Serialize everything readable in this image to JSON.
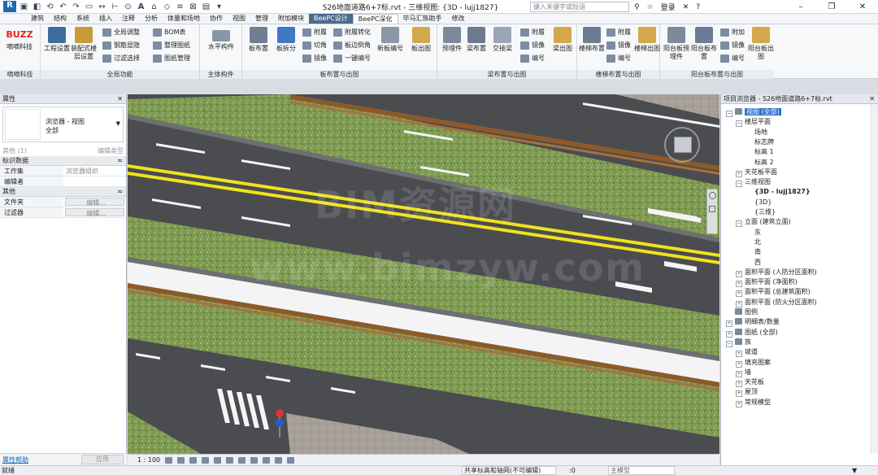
{
  "titlebar": {
    "doc_title": "S26地面道路6+7标.rvt - 三维视图: {3D - lujj1827}",
    "search_placeholder": "键入关键字或短语",
    "login": "登录",
    "help": "?"
  },
  "tabs": [
    "建筑",
    "结构",
    "系统",
    "插入",
    "注释",
    "分析",
    "体量和场地",
    "协作",
    "视图",
    "管理",
    "附加模块",
    "BeePC设计",
    "BeePC深化",
    "毕马汇族助手",
    "修改"
  ],
  "ribbon": {
    "panels": {
      "p1": "嘀嘀科技",
      "p2": "全局功能",
      "p3": "主体构件",
      "p4": "板布置与出图",
      "p5": "梁布置与出图",
      "p6": "楼梯布置与出图",
      "p7": "阳台板布置与出图"
    },
    "buzz_logo": "BUZZ",
    "buttons": {
      "dd": "嘀嘀科技",
      "gcsz": "工程设置",
      "zpslc": "装配式楼层设置",
      "qjtz": "全局调整",
      "gjyc": "钢筋显隐",
      "glxz": "过滤选择",
      "bom": "BOM表",
      "zltz": "整理图纸",
      "tzgl": "图纸管理",
      "spgj": "水平构件",
      "bbz": "板布置",
      "bcf": "板拆分",
      "fp": "附履",
      "qj": "切角",
      "jx": "镜像",
      "fzzh": "附履转化",
      "bbdj": "板边倒角",
      "yjbh": "一键编号",
      "xbbh": "新板编号",
      "bct": "板出图",
      "ymj": "预埋件",
      "lbz": "梁布置",
      "jjl": "交接梁",
      "lfp": "附履",
      "ljx": "镜像",
      "lbh": "编号",
      "lct": "梁出图",
      "ltbz": "楼梯布置",
      "ltfp": "附履",
      "ltjx": "镜像",
      "ltbh": "编号",
      "ltct": "楼梯出图",
      "ytbymj": "阳台板预埋件",
      "ytbbz": "阳台板布置",
      "ytfj": "附加",
      "ytjx": "镜像",
      "ytbh": "编号",
      "ytbct": "阳台板出图"
    }
  },
  "properties": {
    "title": "属性",
    "type_line1": "浏览器 - 视图",
    "type_line2": "全部",
    "filter_label": "其他 (1)",
    "edit_type": "编辑类型",
    "sections": [
      {
        "label": "标识数据",
        "rows": [
          {
            "k": "工作集",
            "v": "浏览器组织"
          },
          {
            "k": "编辑者",
            "v": ""
          }
        ]
      },
      {
        "label": "其他",
        "rows": [
          {
            "k": "文件夹",
            "v": "编辑..."
          },
          {
            "k": "过滤器",
            "v": "编辑..."
          }
        ]
      }
    ],
    "help_link": "属性帮助",
    "apply": "应用"
  },
  "view": {
    "scale": "1 : 100",
    "watermark1": "BIM资源网",
    "watermark2": "www.bimzyw.com"
  },
  "browser": {
    "title": "项目浏览器 - S26地面道路6+7标.rvt",
    "nodes": [
      {
        "label": "视图 (全部)",
        "level": 0,
        "toggle": "−",
        "icon": true,
        "selected": true
      },
      {
        "label": "楼层平面",
        "level": 1,
        "toggle": "−"
      },
      {
        "label": "场地",
        "level": 2
      },
      {
        "label": "标志牌",
        "level": 2
      },
      {
        "label": "标高 1",
        "level": 2
      },
      {
        "label": "标高 2",
        "level": 2
      },
      {
        "label": "天花板平面",
        "level": 1,
        "toggle": "+"
      },
      {
        "label": "三维视图",
        "level": 1,
        "toggle": "−"
      },
      {
        "label": "{3D - lujj1827}",
        "level": 2,
        "bold": true
      },
      {
        "label": "{3D}",
        "level": 2
      },
      {
        "label": "{三维}",
        "level": 2
      },
      {
        "label": "立面 (建筑立面)",
        "level": 1,
        "toggle": "−"
      },
      {
        "label": "东",
        "level": 2
      },
      {
        "label": "北",
        "level": 2
      },
      {
        "label": "南",
        "level": 2
      },
      {
        "label": "西",
        "level": 2
      },
      {
        "label": "面积平面 (人防分区面积)",
        "level": 1,
        "toggle": "+"
      },
      {
        "label": "面积平面 (净面积)",
        "level": 1,
        "toggle": "+"
      },
      {
        "label": "面积平面 (总建筑面积)",
        "level": 1,
        "toggle": "+"
      },
      {
        "label": "面积平面 (防火分区面积)",
        "level": 1,
        "toggle": "+"
      },
      {
        "label": "图例",
        "level": 0,
        "icon": true
      },
      {
        "label": "明细表/数量",
        "level": 0,
        "toggle": "+",
        "icon": true
      },
      {
        "label": "图纸 (全部)",
        "level": 0,
        "toggle": "+",
        "icon": true
      },
      {
        "label": "族",
        "level": 0,
        "toggle": "−",
        "icon": true
      },
      {
        "label": "坡道",
        "level": 1,
        "toggle": "+"
      },
      {
        "label": "填充图案",
        "level": 1,
        "toggle": "+"
      },
      {
        "label": "墙",
        "level": 1,
        "toggle": "+"
      },
      {
        "label": "天花板",
        "level": 1,
        "toggle": "+"
      },
      {
        "label": "屋顶",
        "level": 1,
        "toggle": "+"
      },
      {
        "label": "常规模型",
        "level": 1,
        "toggle": "+"
      }
    ]
  },
  "statusbar": {
    "left": "就绪",
    "workset": "共享标高和轴网(不可编辑)",
    "count": ":0",
    "model": "主模型"
  },
  "colors": {
    "asphalt": "#4a4c50",
    "grass": "#7e9a52",
    "yellow_line": "#f2e21a",
    "rail": "#8c5a2a",
    "accent": "#2d6fd0"
  }
}
